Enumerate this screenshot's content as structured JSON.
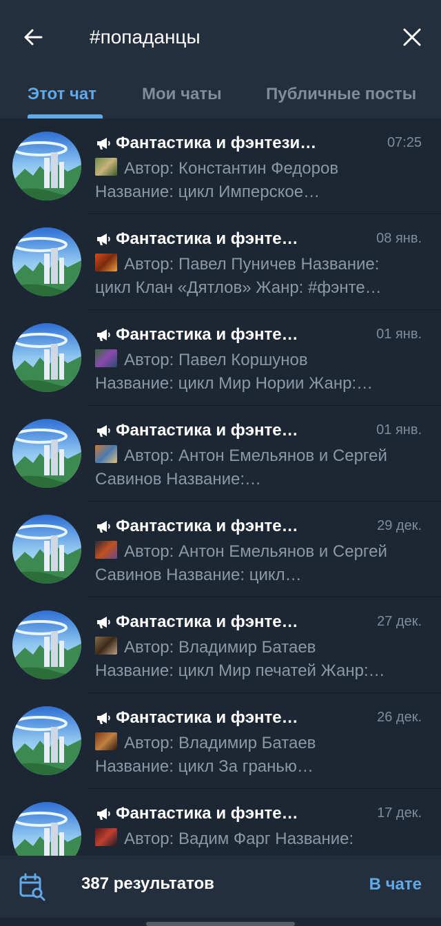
{
  "header": {
    "query": "#попаданцы",
    "back_icon": "arrow-left-icon",
    "close_icon": "close-icon"
  },
  "tabs": [
    {
      "label": "Этот чат",
      "active": true
    },
    {
      "label": "Мои чаты",
      "active": false
    },
    {
      "label": "Публичные посты",
      "active": false
    }
  ],
  "results": [
    {
      "title": "Фантастика и фэнтези…",
      "time": "07:25",
      "line1": "Автор: Константин Федоров",
      "line2": "Название: цикл Имперское…"
    },
    {
      "title": "Фантастика и фэнте…",
      "time": "08 янв.",
      "line1": "Автор: Павел Пуничев Название:",
      "line2": "цикл Клан «Дятлов» Жанр: #фэнте…"
    },
    {
      "title": "Фантастика и фэнте…",
      "time": "01 янв.",
      "line1": "Автор: Павел Коршунов",
      "line2": "Название: цикл Мир Нории Жанр:…"
    },
    {
      "title": "Фантастика и фэнте…",
      "time": "01 янв.",
      "line1": "Автор: Антон Емельянов и Сергей",
      "line2": "Савинов Название:…"
    },
    {
      "title": "Фантастика и фэнте…",
      "time": "29 дек.",
      "line1": "Автор: Антон Емельянов и Сергей",
      "line2": "Савинов Название: цикл…"
    },
    {
      "title": "Фантастика и фэнте…",
      "time": "27 дек.",
      "line1": "Автор: Владимир Батаев",
      "line2": "Название: цикл Мир печатей Жанр:…"
    },
    {
      "title": "Фантастика и фэнте…",
      "time": "26 дек.",
      "line1": "Автор: Владимир Батаев",
      "line2": "Название: цикл За гранью…"
    },
    {
      "title": "Фантастика и фэнте…",
      "time": "17 дек.",
      "line1": "Автор: Вадим Фарг Название:",
      "line2": ""
    }
  ],
  "bottom": {
    "count": "387 результатов",
    "in_chat": "В чате",
    "calendar_icon": "calendar-search-icon"
  },
  "colors": {
    "background": "#1d2733",
    "header": "#242f3d",
    "accent": "#62a9ea",
    "secondary_text": "#8b98a6"
  }
}
